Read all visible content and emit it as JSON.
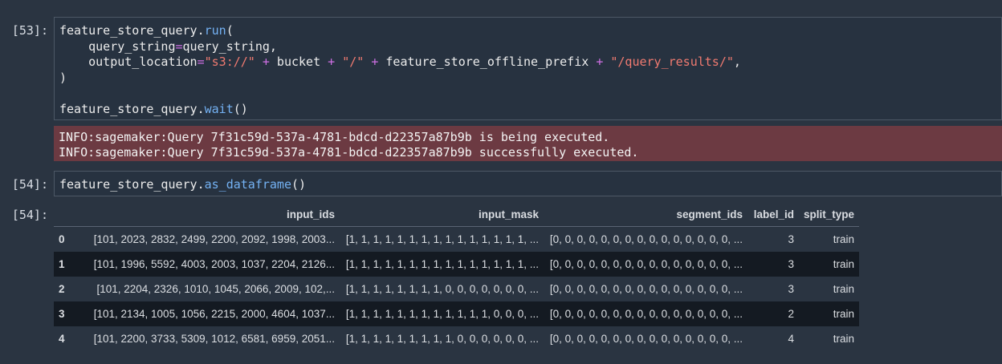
{
  "cells": [
    {
      "prompt": "[53]:",
      "code_lines": [
        [
          {
            "t": "feature_store_query."
          },
          {
            "t": "run",
            "c": "fn"
          },
          {
            "t": "("
          }
        ],
        [
          {
            "t": "    query_string"
          },
          {
            "t": "=",
            "c": "op"
          },
          {
            "t": "query_string,"
          }
        ],
        [
          {
            "t": "    output_location"
          },
          {
            "t": "=",
            "c": "op"
          },
          {
            "t": "\"s3://\"",
            "c": "str"
          },
          {
            "t": " "
          },
          {
            "t": "+",
            "c": "op"
          },
          {
            "t": " bucket "
          },
          {
            "t": "+",
            "c": "op"
          },
          {
            "t": " "
          },
          {
            "t": "\"/\"",
            "c": "str"
          },
          {
            "t": " "
          },
          {
            "t": "+",
            "c": "op"
          },
          {
            "t": " feature_store_offline_prefix "
          },
          {
            "t": "+",
            "c": "op"
          },
          {
            "t": " "
          },
          {
            "t": "\"/query_results/\"",
            "c": "str"
          },
          {
            "t": ","
          }
        ],
        [
          {
            "t": ")"
          }
        ],
        [
          {
            "t": ""
          }
        ],
        [
          {
            "t": "feature_store_query."
          },
          {
            "t": "wait",
            "c": "fn"
          },
          {
            "t": "()"
          }
        ]
      ],
      "stderr_lines": [
        "INFO:sagemaker:Query 7f31c59d-537a-4781-bdcd-d22357a87b9b is being executed.",
        "INFO:sagemaker:Query 7f31c59d-537a-4781-bdcd-d22357a87b9b successfully executed."
      ]
    },
    {
      "prompt": "[54]:",
      "code_lines": [
        [
          {
            "t": "feature_store_query."
          },
          {
            "t": "as_dataframe",
            "c": "fn"
          },
          {
            "t": "()"
          }
        ]
      ]
    }
  ],
  "output_prompt": "[54]:",
  "dataframe": {
    "columns": [
      "",
      "input_ids",
      "input_mask",
      "segment_ids",
      "label_id",
      "split_type"
    ],
    "rows": [
      [
        "0",
        "[101, 2023, 2832, 2499, 2200, 2092, 1998, 2003...",
        "[1, 1, 1, 1, 1, 1, 1, 1, 1, 1, 1, 1, 1, 1, 1, ...",
        "[0, 0, 0, 0, 0, 0, 0, 0, 0, 0, 0, 0, 0, 0, 0, ...",
        "3",
        "train"
      ],
      [
        "1",
        "[101, 1996, 5592, 4003, 2003, 1037, 2204, 2126...",
        "[1, 1, 1, 1, 1, 1, 1, 1, 1, 1, 1, 1, 1, 1, 1, ...",
        "[0, 0, 0, 0, 0, 0, 0, 0, 0, 0, 0, 0, 0, 0, 0, ...",
        "3",
        "train"
      ],
      [
        "2",
        "[101, 2204, 2326, 1010, 1045, 2066, 2009, 102,...",
        "[1, 1, 1, 1, 1, 1, 1, 1, 0, 0, 0, 0, 0, 0, 0, ...",
        "[0, 0, 0, 0, 0, 0, 0, 0, 0, 0, 0, 0, 0, 0, 0, ...",
        "3",
        "train"
      ],
      [
        "3",
        "[101, 2134, 1005, 1056, 2215, 2000, 4604, 1037...",
        "[1, 1, 1, 1, 1, 1, 1, 1, 1, 1, 1, 1, 0, 0, 0, ...",
        "[0, 0, 0, 0, 0, 0, 0, 0, 0, 0, 0, 0, 0, 0, 0, ...",
        "2",
        "train"
      ],
      [
        "4",
        "[101, 2200, 3733, 5309, 1012, 6581, 6959, 2051...",
        "[1, 1, 1, 1, 1, 1, 1, 1, 1, 0, 0, 0, 0, 0, 0, ...",
        "[0, 0, 0, 0, 0, 0, 0, 0, 0, 0, 0, 0, 0, 0, 0, ...",
        "4",
        "train"
      ]
    ]
  },
  "colors": {
    "background": "#2a3441",
    "stderr_background": "#6c3a42",
    "function": "#74b2f4",
    "string": "#f07a70",
    "operator": "#d070e6",
    "odd_row": "#141a22"
  }
}
